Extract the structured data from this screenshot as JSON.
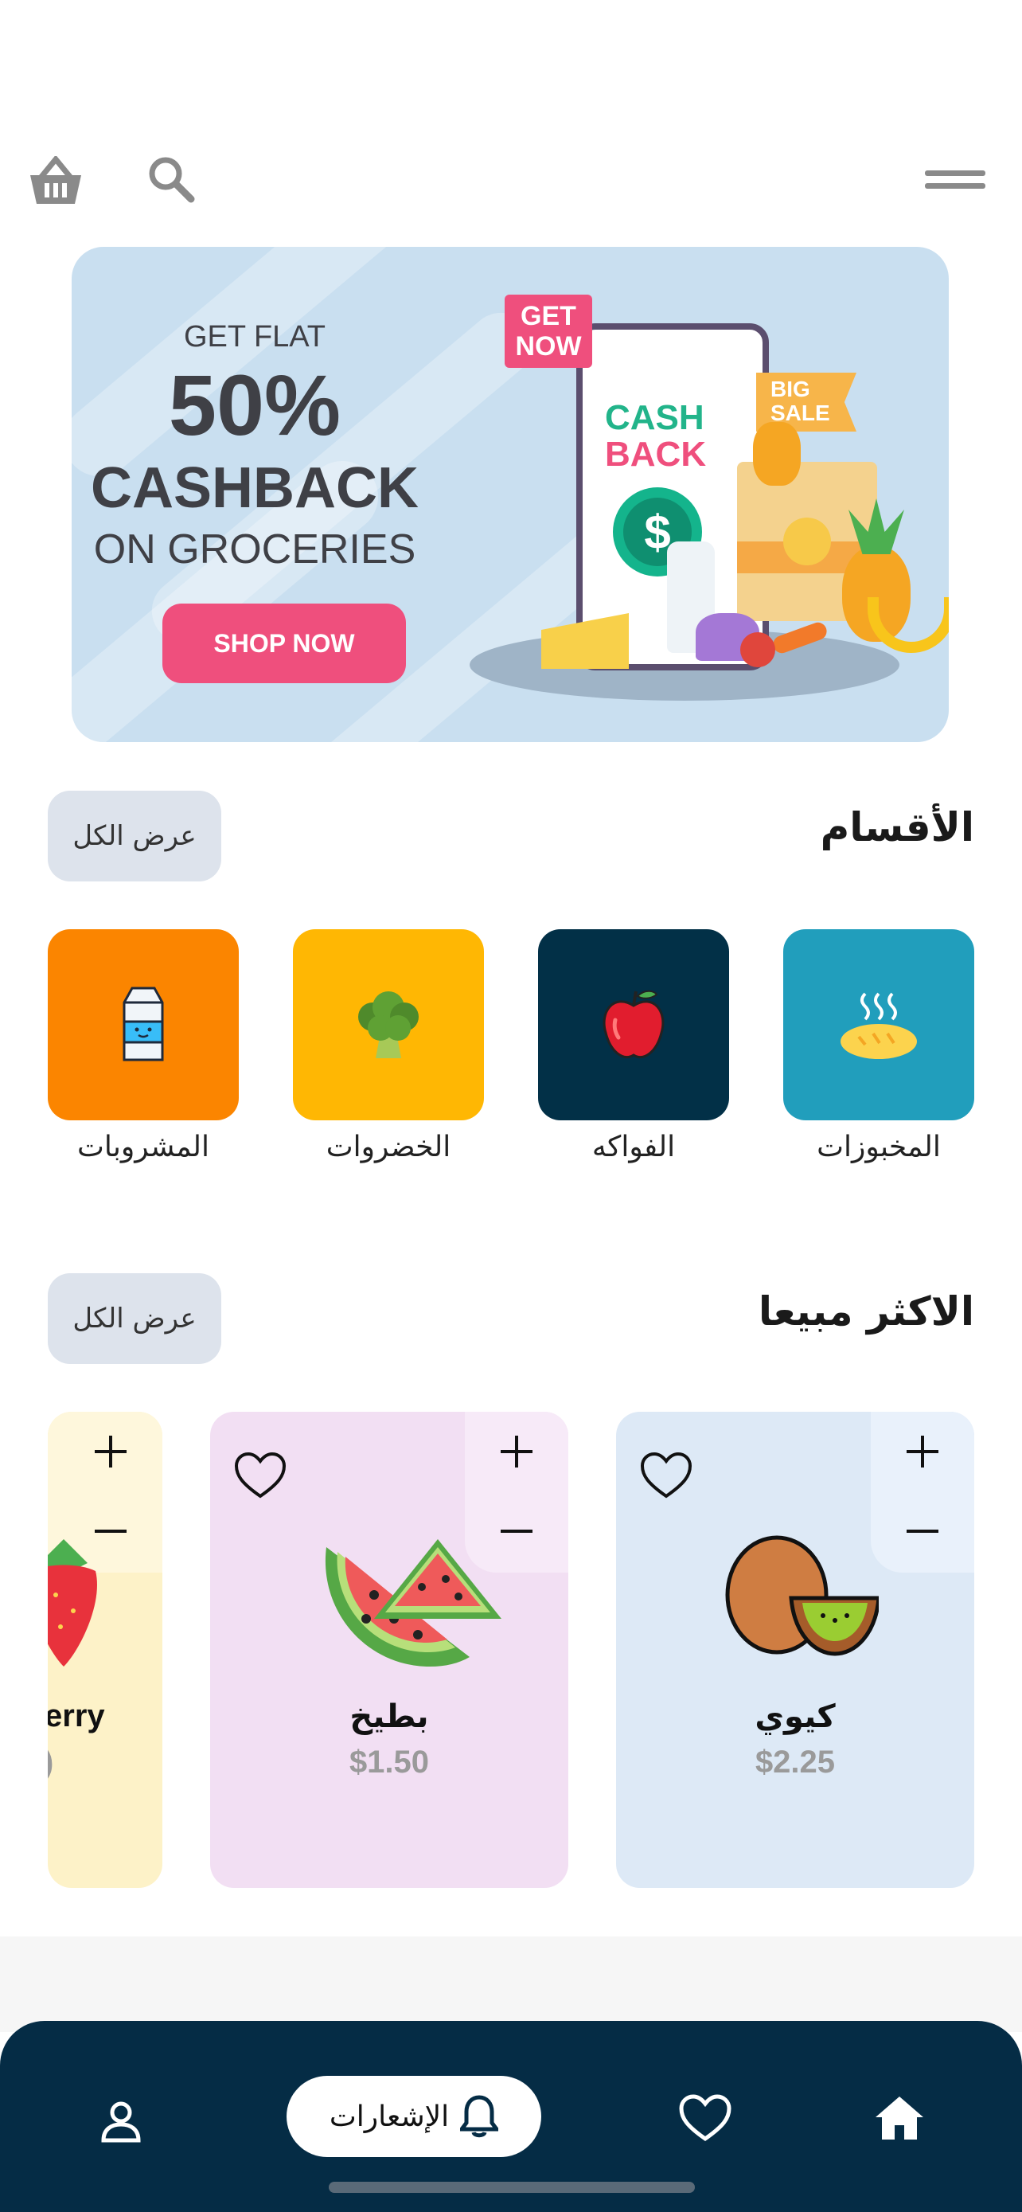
{
  "header": {
    "menu_icon": "menu-icon",
    "search_icon": "search-icon",
    "cart_icon": "basket-icon"
  },
  "banner": {
    "line1": "GET FLAT",
    "line2": "50%",
    "line3": "CASHBACK",
    "line4": "ON GROCERIES",
    "button": "SHOP NOW",
    "tag_get_now_1": "GET",
    "tag_get_now_2": "NOW",
    "phone_cash": "CASH",
    "phone_back": "BACK",
    "big_sale_1": "BIG",
    "big_sale_2": "SALE"
  },
  "categories": {
    "title": "الأقسام",
    "see_all": "عرض الكل",
    "items": [
      {
        "label": "المخبوزات",
        "color": "#219ebc",
        "icon": "bread-icon"
      },
      {
        "label": "الفواكه",
        "color": "#023047",
        "icon": "apple-icon"
      },
      {
        "label": "الخضروات",
        "color": "#ffb703",
        "icon": "broccoli-icon"
      },
      {
        "label": "المشروبات",
        "color": "#fb8500",
        "icon": "milk-icon"
      }
    ]
  },
  "best_sellers": {
    "title": "الاكثر مبيعا",
    "see_all": "عرض الكل",
    "items": [
      {
        "name": "كيوي",
        "price": "$2.25",
        "color": "#dde9f6",
        "icon": "kiwi-icon"
      },
      {
        "name": "بطيخ",
        "price": "$1.50",
        "color": "#f2dff3",
        "icon": "watermelon-icon"
      },
      {
        "name": "erry",
        "price": ")",
        "color": "#fdf2c8",
        "icon": "strawberry-icon"
      }
    ]
  },
  "nav": {
    "notifications_label": "الإشعارات",
    "home_icon": "home-icon",
    "favorites_icon": "heart-icon",
    "profile_icon": "profile-icon"
  },
  "colors": {
    "accent_navy": "#052c45",
    "pink": "#ef4f7d"
  }
}
